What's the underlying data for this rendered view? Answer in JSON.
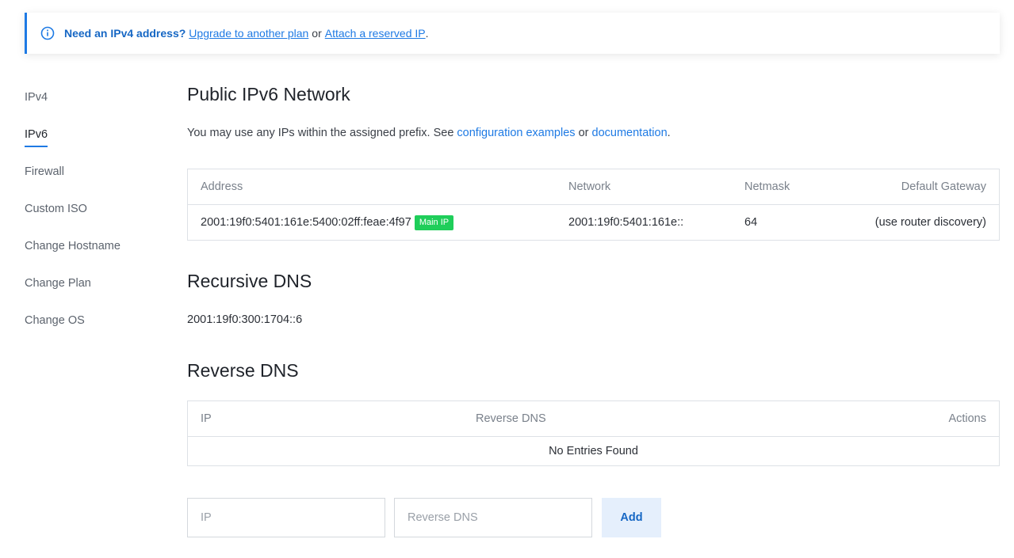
{
  "banner": {
    "icon": "info-icon",
    "strong": "Need an IPv4 address?",
    "link_upgrade": "Upgrade to another plan",
    "or": "or",
    "link_attach": "Attach a reserved IP",
    "dot": ".",
    "accent": "#1e7ae4"
  },
  "sidebar": {
    "items": [
      {
        "label": "IPv4"
      },
      {
        "label": "IPv6"
      },
      {
        "label": "Firewall"
      },
      {
        "label": "Custom ISO"
      },
      {
        "label": "Change Hostname"
      },
      {
        "label": "Change Plan"
      },
      {
        "label": "Change OS"
      }
    ],
    "active": "IPv6"
  },
  "ipv6": {
    "title": "Public IPv6 Network",
    "intro_prefix": "You may use any IPs within the assigned prefix. See",
    "link_config": "configuration examples",
    "or": "or",
    "link_docs": "documentation",
    "dot": ".",
    "columns": [
      "Address",
      "Network",
      "Netmask",
      "Default Gateway"
    ],
    "row": {
      "address": "2001:19f0:5401:161e:5400:02ff:feae:4f97",
      "badge": "Main IP",
      "network": "2001:19f0:5401:161e::",
      "netmask": "64",
      "gateway": "(use router discovery)"
    },
    "badge_color": "#1fce5a"
  },
  "recursive_dns": {
    "title": "Recursive DNS",
    "value": "2001:19f0:300:1704::6"
  },
  "reverse_dns": {
    "title": "Reverse DNS",
    "columns": [
      "IP",
      "Reverse DNS",
      "Actions"
    ],
    "empty": "No Entries Found",
    "form": {
      "ip_placeholder": "IP",
      "rdns_placeholder": "Reverse DNS",
      "add_label": "Add"
    }
  }
}
